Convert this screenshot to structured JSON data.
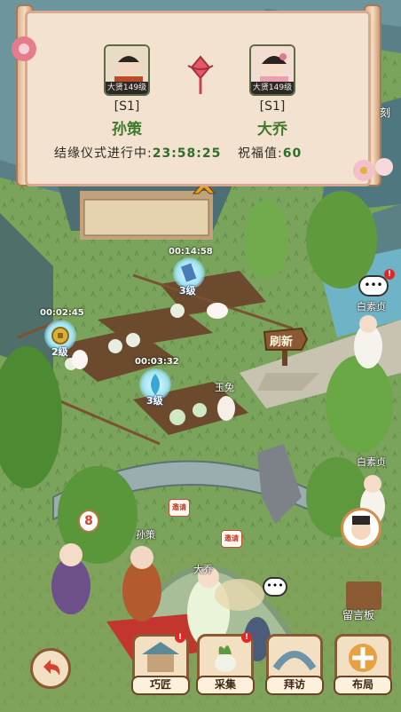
{
  "banner": {
    "player_left": {
      "server": "[S1]",
      "name": "孙策",
      "level": "大贤149级"
    },
    "player_right": {
      "server": "[S1]",
      "name": "大乔",
      "level": "大贤149级"
    },
    "ceremony_label": "结缘仪式进行中:",
    "ceremony_timer": "23:58:25",
    "blessing_label": "祝福值:",
    "blessing_value": "60",
    "corner_text": "刻"
  },
  "plots": [
    {
      "timer": "00:14:58",
      "level": "3级"
    },
    {
      "timer": "00:02:45",
      "level": "2级"
    },
    {
      "timer": "00:03:32",
      "level": "3级"
    }
  ],
  "refresh_sign": "刷新",
  "npc_labels": {
    "jade_rabbit": "玉兔",
    "bai_suzhen_top": "白素贞",
    "bai_suzhen_bottom": "白素贞",
    "sun_ce": "孙策",
    "da_qiao": "大乔"
  },
  "invite_tag": "邀请",
  "message_board": "留言板",
  "bottom_buttons": {
    "craft": "巧匠",
    "collect": "采集",
    "visit": "拜访",
    "layout": "布局"
  },
  "alert_mark": "!"
}
